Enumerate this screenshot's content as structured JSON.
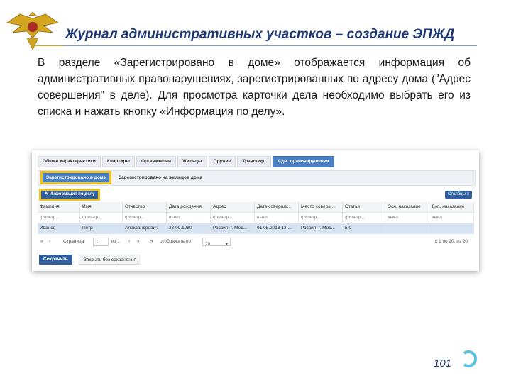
{
  "header": {
    "title": "Журнал административных участков – создание ЭПЖД"
  },
  "description": "В разделе «Зарегистрировано в доме» отображается информация об административных правонарушениях, зарегистрированных по адресу дома (\"Адрес совершения\" в деле). Для просмотра карточки дела необходимо выбрать его из списка и нажать кнопку «Информация по делу».",
  "app": {
    "tabs": [
      "Общие характеристики",
      "Квартиры",
      "Организации",
      "Жильцы",
      "Оружие",
      "Транспорт",
      "Адм. правонарушения"
    ],
    "active_tab": "Адм. правонарушения",
    "subtabs": {
      "selected": "Зарегистрировано в доме",
      "other": "Зарегистрировано на жильцов дома"
    },
    "info_button": "Информация по делу",
    "columns_button": "Столбцы",
    "columns": [
      "Фамилия",
      "Имя",
      "Отчество",
      "Дата рождения",
      "Адрес",
      "Дата соверше...",
      "Место соверш...",
      "Статья",
      "Осн. наказание",
      "Доп. наказание"
    ],
    "filters": [
      "фильтр...",
      "фильтр...",
      "фильтр...",
      "выкл",
      "фильтр...",
      "выкл",
      "фильтр...",
      "фильтр...",
      "выкл",
      "выкл"
    ],
    "rows": [
      [
        "Иванов",
        "Петр",
        "Александрович",
        "28.09.1980",
        "Россия, г. Мос...",
        "01.05.2018 12:...",
        "Россия, г. Мос...",
        "5.9",
        "",
        ""
      ]
    ],
    "pager": {
      "page_label": "Страница",
      "page_value": "1",
      "of_label": "из 1",
      "show_label": "отображать по",
      "show_value": "20",
      "summary": "с 1 по 20, из 20"
    },
    "save_button": "Сохранить",
    "close_button": "Закрыть без сохранения"
  },
  "page_number": "101",
  "colors": {
    "title": "#1f3a78",
    "highlight": "#f3c21a",
    "button": "#2f5f9e",
    "active_tab": "#4a7fc1"
  }
}
